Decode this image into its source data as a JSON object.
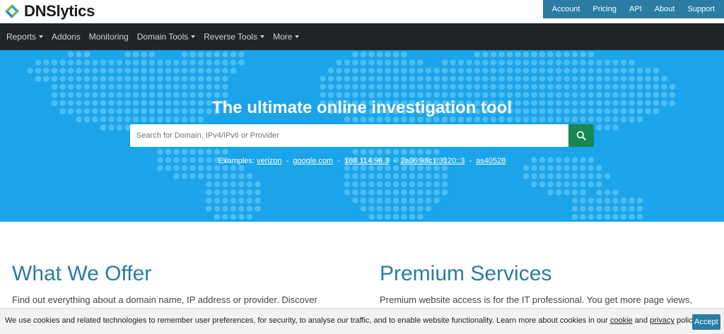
{
  "brand": {
    "name": "DNSlytics"
  },
  "account_nav": {
    "items": [
      "Account",
      "Pricing",
      "API",
      "About",
      "Support"
    ]
  },
  "main_nav": {
    "items": [
      {
        "label": "Reports",
        "dropdown": true
      },
      {
        "label": "Addons",
        "dropdown": false
      },
      {
        "label": "Monitoring",
        "dropdown": false
      },
      {
        "label": "Domain Tools",
        "dropdown": true
      },
      {
        "label": "Reverse Tools",
        "dropdown": true
      },
      {
        "label": "More",
        "dropdown": true
      }
    ]
  },
  "hero": {
    "title": "The ultimate online investigation tool",
    "search": {
      "placeholder": "Search for Domain, IPv4/IPv6 or Provider",
      "value": ""
    },
    "examples_label": "Examples:",
    "examples": [
      "verizon",
      "google.com",
      "188.114.96.3",
      "2a06:98c1:3120::3",
      "as40528"
    ]
  },
  "offer": {
    "title": "What We Offer",
    "text": "Find out everything about a domain name, IP address or provider. Discover"
  },
  "premium": {
    "title": "Premium Services",
    "text": "Premium website access is for the IT professional. You get more page views,"
  },
  "cookie": {
    "text_before": "We use cookies and related technologies to remember user preferences, for security, to analyse our traffic, and to enable website functionality. Learn more about cookies in our",
    "cookie_link": "cookie",
    "and": "and",
    "privacy_link": "privacy",
    "text_after": "policy.",
    "accept": "Accept"
  },
  "colors": {
    "hero_bg": "#1ba4ea",
    "hero_dots": "#4cbef2",
    "nav_bg": "#212529",
    "accent": "#2a7ca3",
    "search_button": "#198754"
  }
}
